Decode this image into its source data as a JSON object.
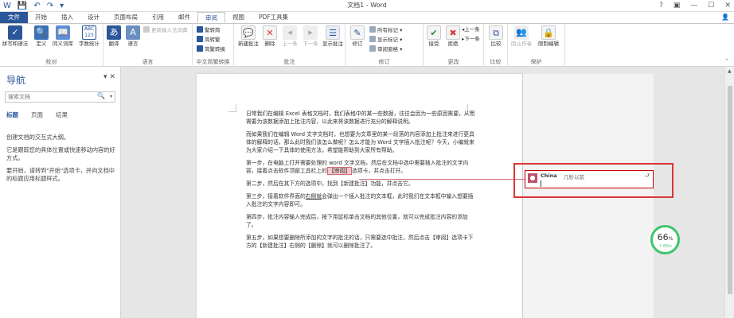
{
  "window": {
    "title": "文档1 - Word",
    "controls": [
      "?",
      "▣",
      "—",
      "☐",
      "✕"
    ]
  },
  "qat": [
    "W",
    "💾",
    "↶",
    "↷",
    "▾"
  ],
  "tabs": [
    "文件",
    "开始",
    "插入",
    "设计",
    "页面布局",
    "引用",
    "邮件",
    "审阅",
    "视图",
    "PDF工具集"
  ],
  "active_tab": "审阅",
  "ribbon": {
    "proofing": {
      "label": "校对",
      "spell": "拼写和语法",
      "define": "定义",
      "thesaurus": "同义词库",
      "wordcount": "字数统计"
    },
    "language": {
      "label": "语言",
      "translate": "翻译",
      "language": "语言",
      "update_ime": "更新输入法词典"
    },
    "chinese": {
      "label": "中文简繁转换",
      "to_simplified": "繁转简",
      "to_traditional": "简转繁",
      "convert": "简繁转换"
    },
    "comments": {
      "label": "批注",
      "new": "新建批注",
      "delete": "删除",
      "previous": "上一条",
      "next": "下一条",
      "show": "显示批注"
    },
    "tracking": {
      "label": "修订",
      "track": "修订",
      "markup_select": "所有标记",
      "show_markup": "显示标记",
      "reviewing_pane": "审阅窗格"
    },
    "changes": {
      "label": "更改",
      "accept": "接受",
      "reject": "拒绝",
      "previous": "上一条",
      "next": "下一条"
    },
    "compare": {
      "label": "比较",
      "compare": "比较"
    },
    "protect": {
      "label": "保护",
      "block": "阻止作者",
      "restrict": "限制编辑"
    }
  },
  "nav": {
    "title": "导航",
    "search_placeholder": "搜索文档",
    "tabs": [
      "标题",
      "页面",
      "结果"
    ],
    "body": [
      "创建文档的交互式大纲。",
      "它是跟踪您的具体位置或快速移动内容的好方式。",
      "要开始，请转到\"开始\"选项卡，并向文档中的标题应用标题样式。"
    ]
  },
  "document": {
    "p1": "日常我们在编辑 Excel 表格文档时，我们表格中的某一些数据，往往会因为一些原因需要，从而需要为该数据添加上批注内容，以此来将该数据进行充分的解释说明。",
    "p2": "而如果我们在编辑 Word 文字文档时，也想要为文章里的某一段落的内容添加上批注来进行更具体的解释的话，那么此时我们该怎么做呢？怎么才能为 Word 文字插入批注呢？今天，小编就来为大家介绍一下具体的使用方法，希望能帮助到大家所有帮助。",
    "p3_a": "第一步，在电脑上打开需要处理的 word 文字文档，然后在文档中选中需要插入批注的文字内容，接着点击软件顶部工具栏上的",
    "p3_hl": "【审阅】",
    "p3_b": "选项卡，并点击打开。",
    "p4": "第二步，然后在其下方的选项中，找到【新建批注】功能，并点击它。",
    "p5_a": "第三步，接着软件界面的",
    "p5_u": "右侧就",
    "p5_b": "会弹出一个插入批注的文本框，此时我们在文本框中输入想要插入批注的文字内容即可。",
    "p6": "第四步，批注内容输入完成后，按下用鼠标单击文档的其他位置，就可以完成批注内容的添加了。",
    "p7": "第五步，如果想要删除所添加的文字的批注的话，只需要选中批注，然后点击【审阅】选项卡下方的【新建批注】右侧的【删除】就可以删除批注了。"
  },
  "comment": {
    "author": "China",
    "time": "几秒以前",
    "reply_icon": "reply-icon"
  },
  "gauge": {
    "percent": "66",
    "unit": "%",
    "speed": "↑ 6K/s"
  },
  "colors": {
    "accent": "#2b579a",
    "highlight": "#d93636",
    "gauge": "#3ec46d"
  }
}
